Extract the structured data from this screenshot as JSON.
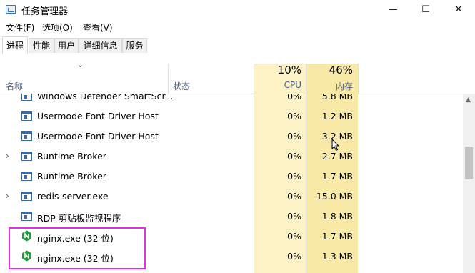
{
  "window": {
    "title": "任务管理器",
    "min_glyph": "—",
    "max_glyph": "☐",
    "close_glyph": "✕"
  },
  "menu": [
    "文件(F)",
    "选项(O)",
    "查看(V)"
  ],
  "tabs": [
    "进程",
    "性能",
    "用户",
    "详细信息",
    "服务"
  ],
  "columns": {
    "name": "名称",
    "status": "状态",
    "cpu_pct": "10%",
    "cpu_label": "CPU",
    "mem_pct": "46%",
    "mem_label": "内存",
    "sort_glyph": "⌄"
  },
  "rows": [
    {
      "name": "Windows Defender SmartScr...",
      "cpu": "0%",
      "mem": "5.8 MB",
      "expander": "",
      "icon": "window-process-icon"
    },
    {
      "name": "Usermode Font Driver Host",
      "cpu": "0%",
      "mem": "1.2 MB",
      "expander": "",
      "icon": "window-process-icon"
    },
    {
      "name": "Usermode Font Driver Host",
      "cpu": "0%",
      "mem": "3.2 MB",
      "expander": "",
      "icon": "window-process-icon"
    },
    {
      "name": "Runtime Broker",
      "cpu": "0%",
      "mem": "2.7 MB",
      "expander": "›",
      "icon": "window-process-icon"
    },
    {
      "name": "Runtime Broker",
      "cpu": "0%",
      "mem": "1.7 MB",
      "expander": "",
      "icon": "window-process-icon"
    },
    {
      "name": "redis-server.exe",
      "cpu": "0%",
      "mem": "15.0 MB",
      "expander": "›",
      "icon": "window-process-icon"
    },
    {
      "name": "RDP 剪贴板监视程序",
      "cpu": "0%",
      "mem": "1.8 MB",
      "expander": "",
      "icon": "window-process-icon"
    },
    {
      "name": "nginx.exe (32 位)",
      "cpu": "0%",
      "mem": "1.7 MB",
      "expander": "",
      "icon": "nginx-icon"
    },
    {
      "name": "nginx.exe (32 位)",
      "cpu": "0%",
      "mem": "1.3 MB",
      "expander": "",
      "icon": "nginx-icon"
    }
  ],
  "colors": {
    "cpu_column": "#fcf2c5",
    "memory_column": "#f9e9a6",
    "highlight_box": "#e62ee6",
    "nginx_green": "#1f9b3c"
  }
}
